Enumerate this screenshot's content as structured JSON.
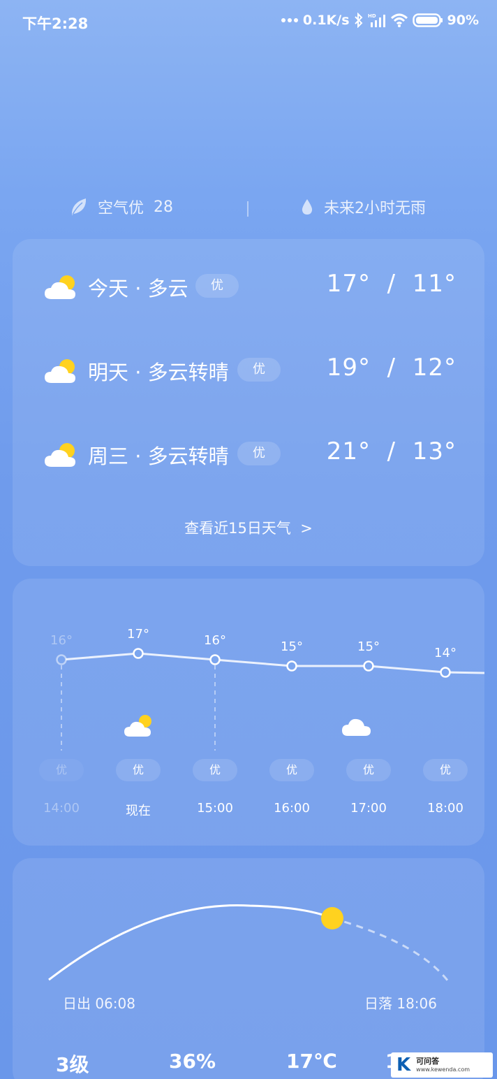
{
  "status_bar": {
    "time": "下午2:28",
    "network_speed": "0.1K/s",
    "battery": "90%",
    "icons": [
      "more-dots-icon",
      "bluetooth-icon",
      "hd-signal-icon",
      "wifi-icon",
      "battery-icon"
    ]
  },
  "air_info": {
    "quality_label": "空气优",
    "quality_value": "28",
    "rain_text": "未来2小时无雨",
    "icons": [
      "leaf-icon",
      "water-drop-icon"
    ]
  },
  "forecast": {
    "days": [
      {
        "label": "今天 · 多云",
        "aqi": "优",
        "high": "17°",
        "low": "11°",
        "icon": "partly-cloudy-icon"
      },
      {
        "label": "明天 · 多云转晴",
        "aqi": "优",
        "high": "19°",
        "low": "12°",
        "icon": "partly-cloudy-icon"
      },
      {
        "label": "周三 · 多云转晴",
        "aqi": "优",
        "high": "21°",
        "low": "13°",
        "icon": "partly-cloudy-icon"
      }
    ],
    "separator": "/",
    "more_link": "查看近15日天气",
    "more_arrow": ">"
  },
  "hourly": {
    "hours": [
      {
        "time": "14:00",
        "temp": "16°",
        "aqi": "优",
        "past": true
      },
      {
        "time": "现在",
        "temp": "17°",
        "aqi": "优",
        "past": false
      },
      {
        "time": "15:00",
        "temp": "16°",
        "aqi": "优",
        "past": false
      },
      {
        "time": "16:00",
        "temp": "15°",
        "aqi": "优",
        "past": false
      },
      {
        "time": "17:00",
        "temp": "15°",
        "aqi": "优",
        "past": false
      },
      {
        "time": "18:00",
        "temp": "14°",
        "aqi": "优",
        "past": false
      }
    ],
    "temp_values": [
      16,
      17,
      16,
      15,
      15,
      14
    ],
    "weather_icons": [
      "partly-cloudy-icon",
      "cloudy-icon"
    ]
  },
  "sun": {
    "sunrise": "日出 06:08",
    "sunset": "日落 18:06",
    "stats": [
      "3级",
      "36%",
      "17℃",
      "1"
    ]
  },
  "watermark": {
    "logo": "K",
    "title": "可问答",
    "url": "www.kewenda.com"
  },
  "colors": {
    "sun": "#ffd21f",
    "background": "#6f9bec"
  }
}
